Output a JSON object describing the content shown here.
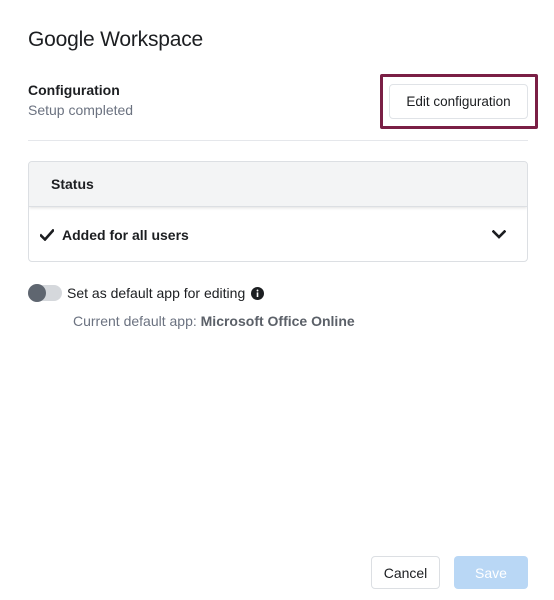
{
  "dialog": {
    "title": "Google Workspace"
  },
  "configuration": {
    "label": "Configuration",
    "status": "Setup completed",
    "edit_button_label": "Edit configuration",
    "highlight_color": "#7a1f45"
  },
  "status_panel": {
    "header": "Status",
    "row_text": "Added for all users",
    "row_icon": "check-icon",
    "expand_icon": "chevron-down-icon"
  },
  "default_app": {
    "toggle_label": "Set as default app for editing",
    "toggle_on": false,
    "info_icon": "info-icon",
    "current_prefix": "Current default app:",
    "current_app": "Microsoft Office Online"
  },
  "footer": {
    "cancel_label": "Cancel",
    "save_label": "Save",
    "save_disabled": true,
    "save_color": "#b9d7f5"
  }
}
